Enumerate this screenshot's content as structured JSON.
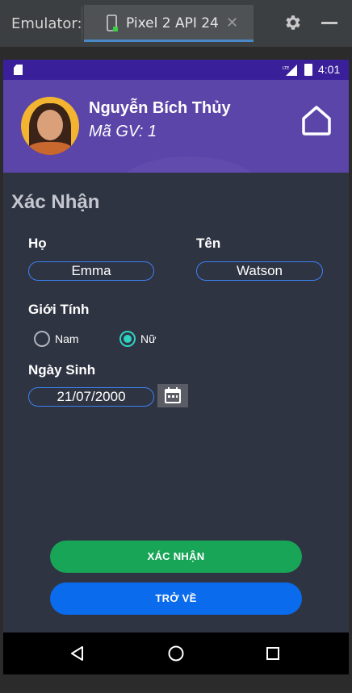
{
  "emulator": {
    "label": "Emulator:",
    "tab_label": "Pixel 2 API 24",
    "close_glyph": "✕"
  },
  "status_bar": {
    "network": "LTE",
    "time": "4:01"
  },
  "header": {
    "user_name": "Nguyễn Bích Thủy",
    "user_id": "Mã GV: 1"
  },
  "form": {
    "title": "Xác Nhận",
    "last_name_label": "Họ",
    "last_name_value": "Emma",
    "first_name_label": "Tên",
    "first_name_value": "Watson",
    "gender_label": "Giới Tính",
    "gender_options": [
      "Nam",
      "Nữ"
    ],
    "gender_selected": "Nữ",
    "dob_label": "Ngày Sinh",
    "dob_value": "21/07/2000"
  },
  "buttons": {
    "confirm": "XÁC NHẬN",
    "back": "TRỞ VỀ"
  },
  "colors": {
    "status_bar": "#3a1f9a",
    "header": "#5b45a8",
    "background": "#2f3442",
    "field_border": "#3b82f6",
    "radio_selected": "#2fd2c1",
    "confirm_button": "#18a558",
    "back_button": "#0a6bec"
  },
  "icons": [
    "phone-device-icon",
    "settings-icon",
    "minimize-icon",
    "sd-card-icon",
    "lte-signal-icon",
    "battery-icon",
    "home-icon",
    "calendar-icon",
    "back-nav-icon",
    "home-nav-icon",
    "recents-nav-icon"
  ]
}
